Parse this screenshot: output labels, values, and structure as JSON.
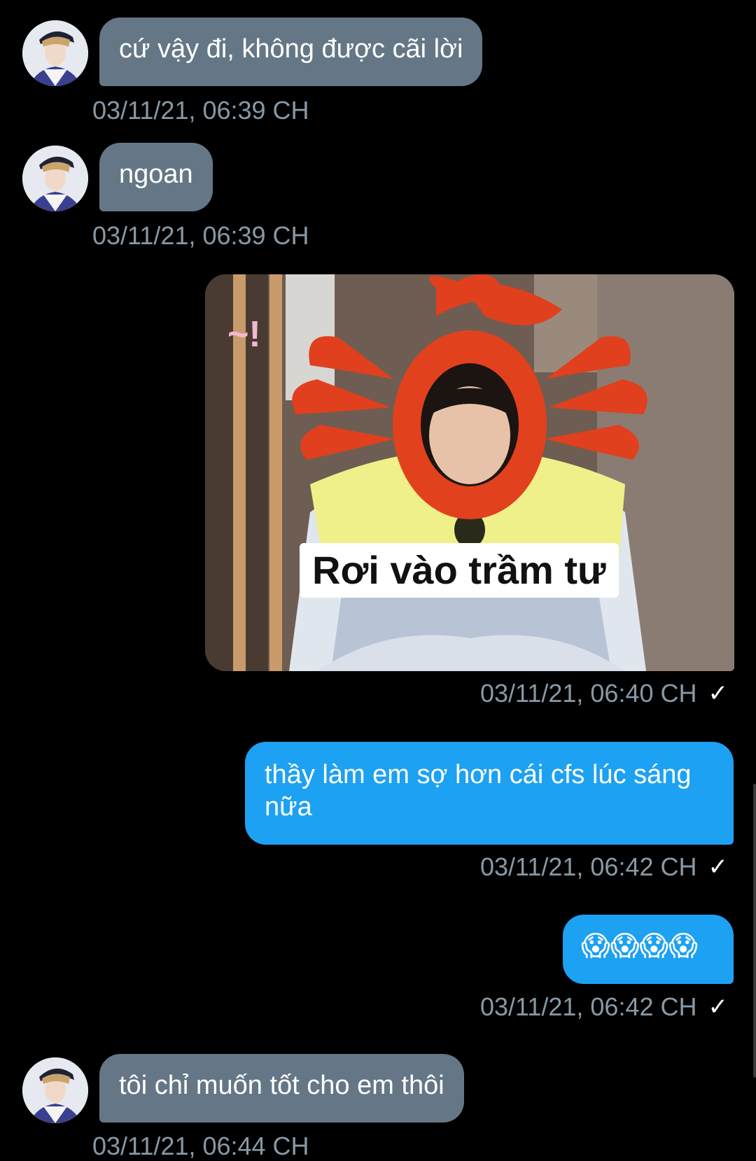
{
  "messages": [
    {
      "text": "cứ vậy đi, không được cãi lời",
      "time": "03/11/21, 06:39 CH"
    },
    {
      "text": "ngoan",
      "time": "03/11/21, 06:39 CH"
    },
    {
      "image_caption": "Rơi vào trầm tư",
      "time": "03/11/21, 06:40 CH"
    },
    {
      "text": "thầy làm em sợ hơn cái cfs lúc sáng nữa",
      "time": "03/11/21, 06:42 CH"
    },
    {
      "text": "😱😱😱😱",
      "time": "03/11/21, 06:42 CH"
    },
    {
      "text": "tôi chỉ muốn tốt cho em thôi",
      "time": "03/11/21, 06:44 CH"
    }
  ],
  "sticker_text": "~!",
  "check_glyph": "✓",
  "colors": {
    "background": "#000000",
    "incoming_bubble": "#657786",
    "outgoing_bubble": "#1da1f2",
    "timestamp": "#8899a6"
  }
}
